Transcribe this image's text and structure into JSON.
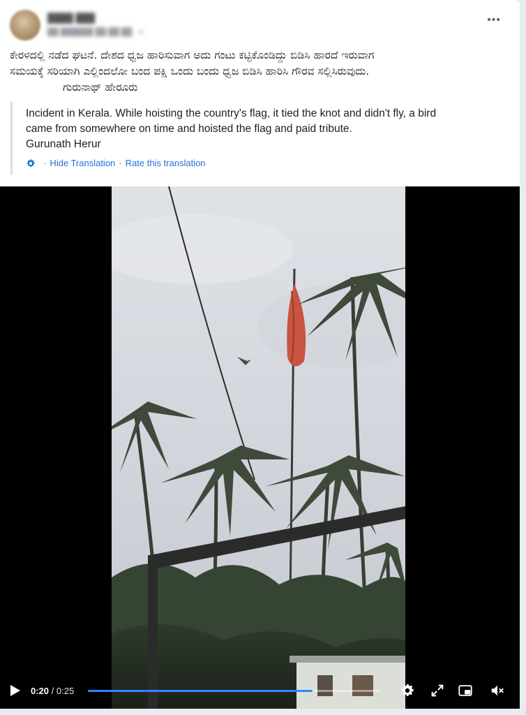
{
  "post": {
    "original_text": [
      "ಕೇರಳದಲ್ಲಿ ನಡೆದ ಘಟನೆ. ದೇಶದ ಧ್ವಜ ಹಾರಿಸುವಾಗ ಅದು ಗಂಟು ಕಟ್ಟಿಕೊಂಡಿದ್ದು ಬಿಡಿಸಿ ಹಾರದೆ ಇರುವಾಗ",
      "ಸಮಯಕ್ಕೆ ಸರಿಯಾಗಿ ಎಲ್ಲಿಂದಲೋ ಬಂದ ಪಕ್ಷಿ ಒಂದು ಬಂದು ಧ್ವಜ ಬಿಡಿಸಿ ಹಾರಿಸಿ ಗೌರವ ಸಲ್ಲಿಸಿರುವುದು."
    ],
    "original_signature": "ಗುರುನಾಥ್ ಹೇರೂರು",
    "more_label": "•••"
  },
  "translation": {
    "lines": [
      "Incident in Kerala. While hoisting the country's flag, it tied the knot and didn't fly, a bird",
      "came from somewhere on time and hoisted the flag and paid tribute.",
      "Gurunath Herur"
    ],
    "hide_label": "Hide Translation",
    "separator": "·",
    "rate_label": "Rate this translation"
  },
  "video": {
    "current_time": "0:20",
    "time_separator": " / ",
    "duration": "0:25",
    "progress_fraction": 0.77,
    "accent_color": "#2d88ff"
  },
  "icons": {
    "translation": "gear-icon",
    "controls": [
      "play-icon",
      "settings-icon",
      "fullscreen-icon",
      "picture-in-picture-icon",
      "volume-muted-icon"
    ]
  }
}
